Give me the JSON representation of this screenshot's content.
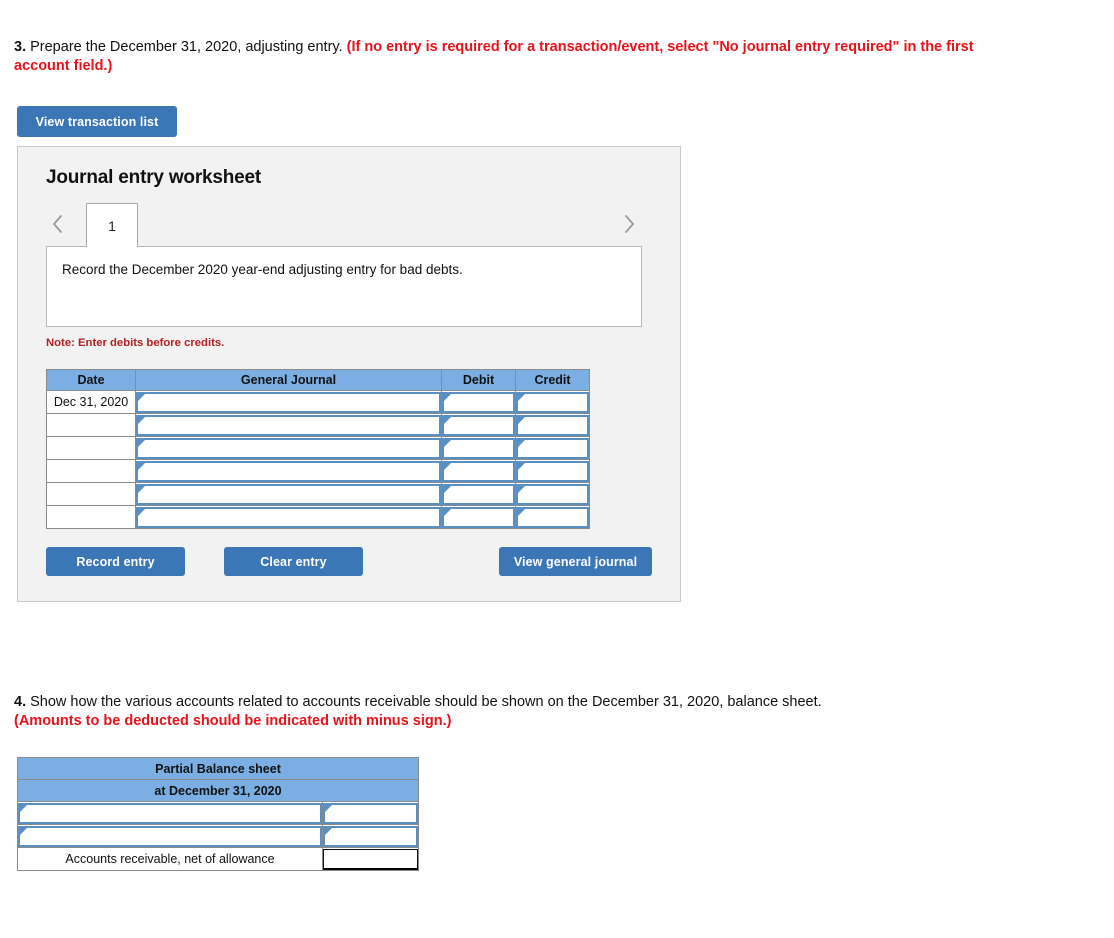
{
  "question3": {
    "number": "3.",
    "body": " Prepare the December 31, 2020, adjusting entry. ",
    "red_note": "(If no entry is required for a transaction/event, select \"No journal entry required\" in the first account field.)"
  },
  "question4": {
    "number": "4.",
    "body": " Show how the various accounts related to accounts receivable should be shown on the December 31, 2020, balance sheet.",
    "red_note": "(Amounts to be deducted should be indicated with minus sign.)"
  },
  "toolbar": {
    "view_transaction_list_label": "View transaction list"
  },
  "worksheet": {
    "title": "Journal entry worksheet",
    "prev_icon": "chevron-left-icon",
    "next_icon": "chevron-right-icon",
    "tabs": [
      {
        "label": "1",
        "selected": true
      }
    ],
    "transaction_description": "Record the December 2020 year-end adjusting entry for bad debts.",
    "note": "Note: Enter debits before credits.",
    "record_entry_label": "Record entry",
    "clear_entry_label": "Clear entry",
    "view_general_journal_label": "View general journal"
  },
  "journal_table": {
    "headers": [
      "Date",
      "General Journal",
      "Debit",
      "Credit"
    ],
    "rows": [
      {
        "date": "Dec 31, 2020",
        "general_journal": "",
        "debit": "",
        "credit": ""
      },
      {
        "date": "",
        "general_journal": "",
        "debit": "",
        "credit": ""
      },
      {
        "date": "",
        "general_journal": "",
        "debit": "",
        "credit": ""
      },
      {
        "date": "",
        "general_journal": "",
        "debit": "",
        "credit": ""
      },
      {
        "date": "",
        "general_journal": "",
        "debit": "",
        "credit": ""
      },
      {
        "date": "",
        "general_journal": "",
        "debit": "",
        "credit": ""
      }
    ]
  },
  "balance_sheet": {
    "title": "Partial Balance sheet",
    "subtitle": "at December 31, 2020",
    "rows": [
      {
        "label": "",
        "amount": "",
        "editable": true
      },
      {
        "label": "",
        "amount": "",
        "editable": true
      },
      {
        "label": "Accounts receivable, net of allowance",
        "amount": "",
        "editable": false
      }
    ]
  },
  "colors": {
    "header_blue": "#7bafe3",
    "button_blue": "#3b76b7",
    "field_border_blue": "#5a8fc4",
    "red_note": "#e8121a",
    "note_red": "#b22222",
    "panel_gray": "#f2f2f2"
  }
}
